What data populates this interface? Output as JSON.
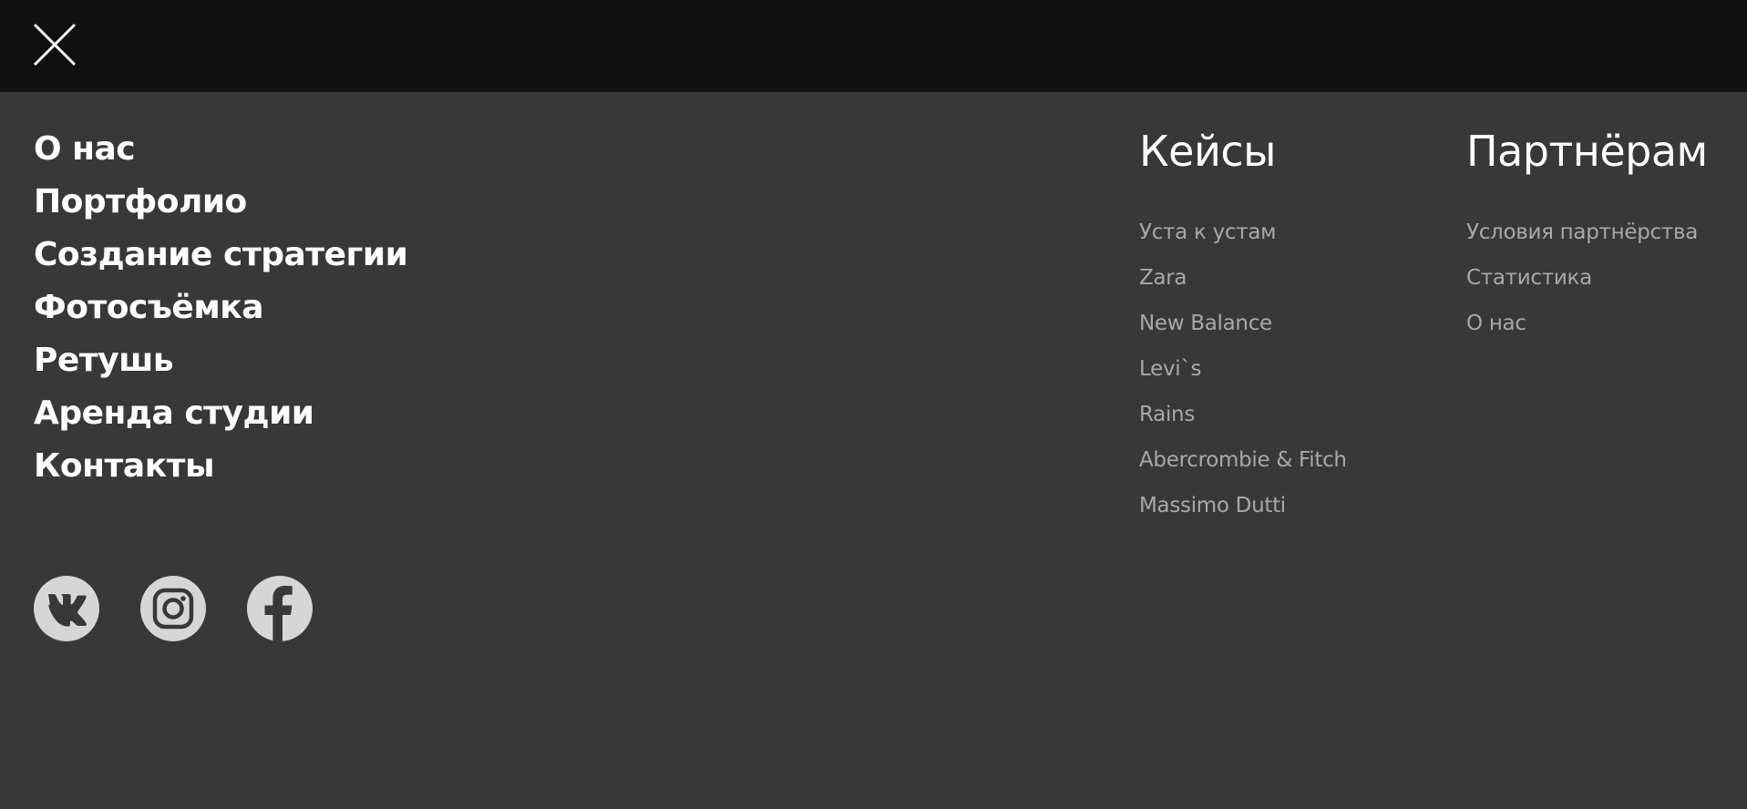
{
  "header": {
    "close_icon": "close-icon"
  },
  "main_nav": {
    "items": [
      "О нас",
      "Портфолио",
      "Создание стратегии",
      "Фотосъёмка",
      "Ретушь",
      "Аренда студии",
      "Контакты"
    ]
  },
  "social": {
    "icons": [
      "vk-icon",
      "instagram-icon",
      "facebook-icon"
    ],
    "icon_bg": "#d6d6d6",
    "icon_fg": "#383838"
  },
  "cases": {
    "title": "Кейсы",
    "items": [
      "Уста к устам",
      "Zara",
      "New Balance",
      "Levi`s",
      "Rains",
      "Abercrombie & Fitch",
      "Massimo Dutti"
    ]
  },
  "partners": {
    "title": "Партнёрам",
    "items": [
      "Условия партнёрства",
      "Статистика",
      "О нас"
    ]
  },
  "colors": {
    "topbar": "#111111",
    "background": "#383838",
    "primary_text": "#ffffff",
    "secondary_text": "#a8a8a8"
  }
}
